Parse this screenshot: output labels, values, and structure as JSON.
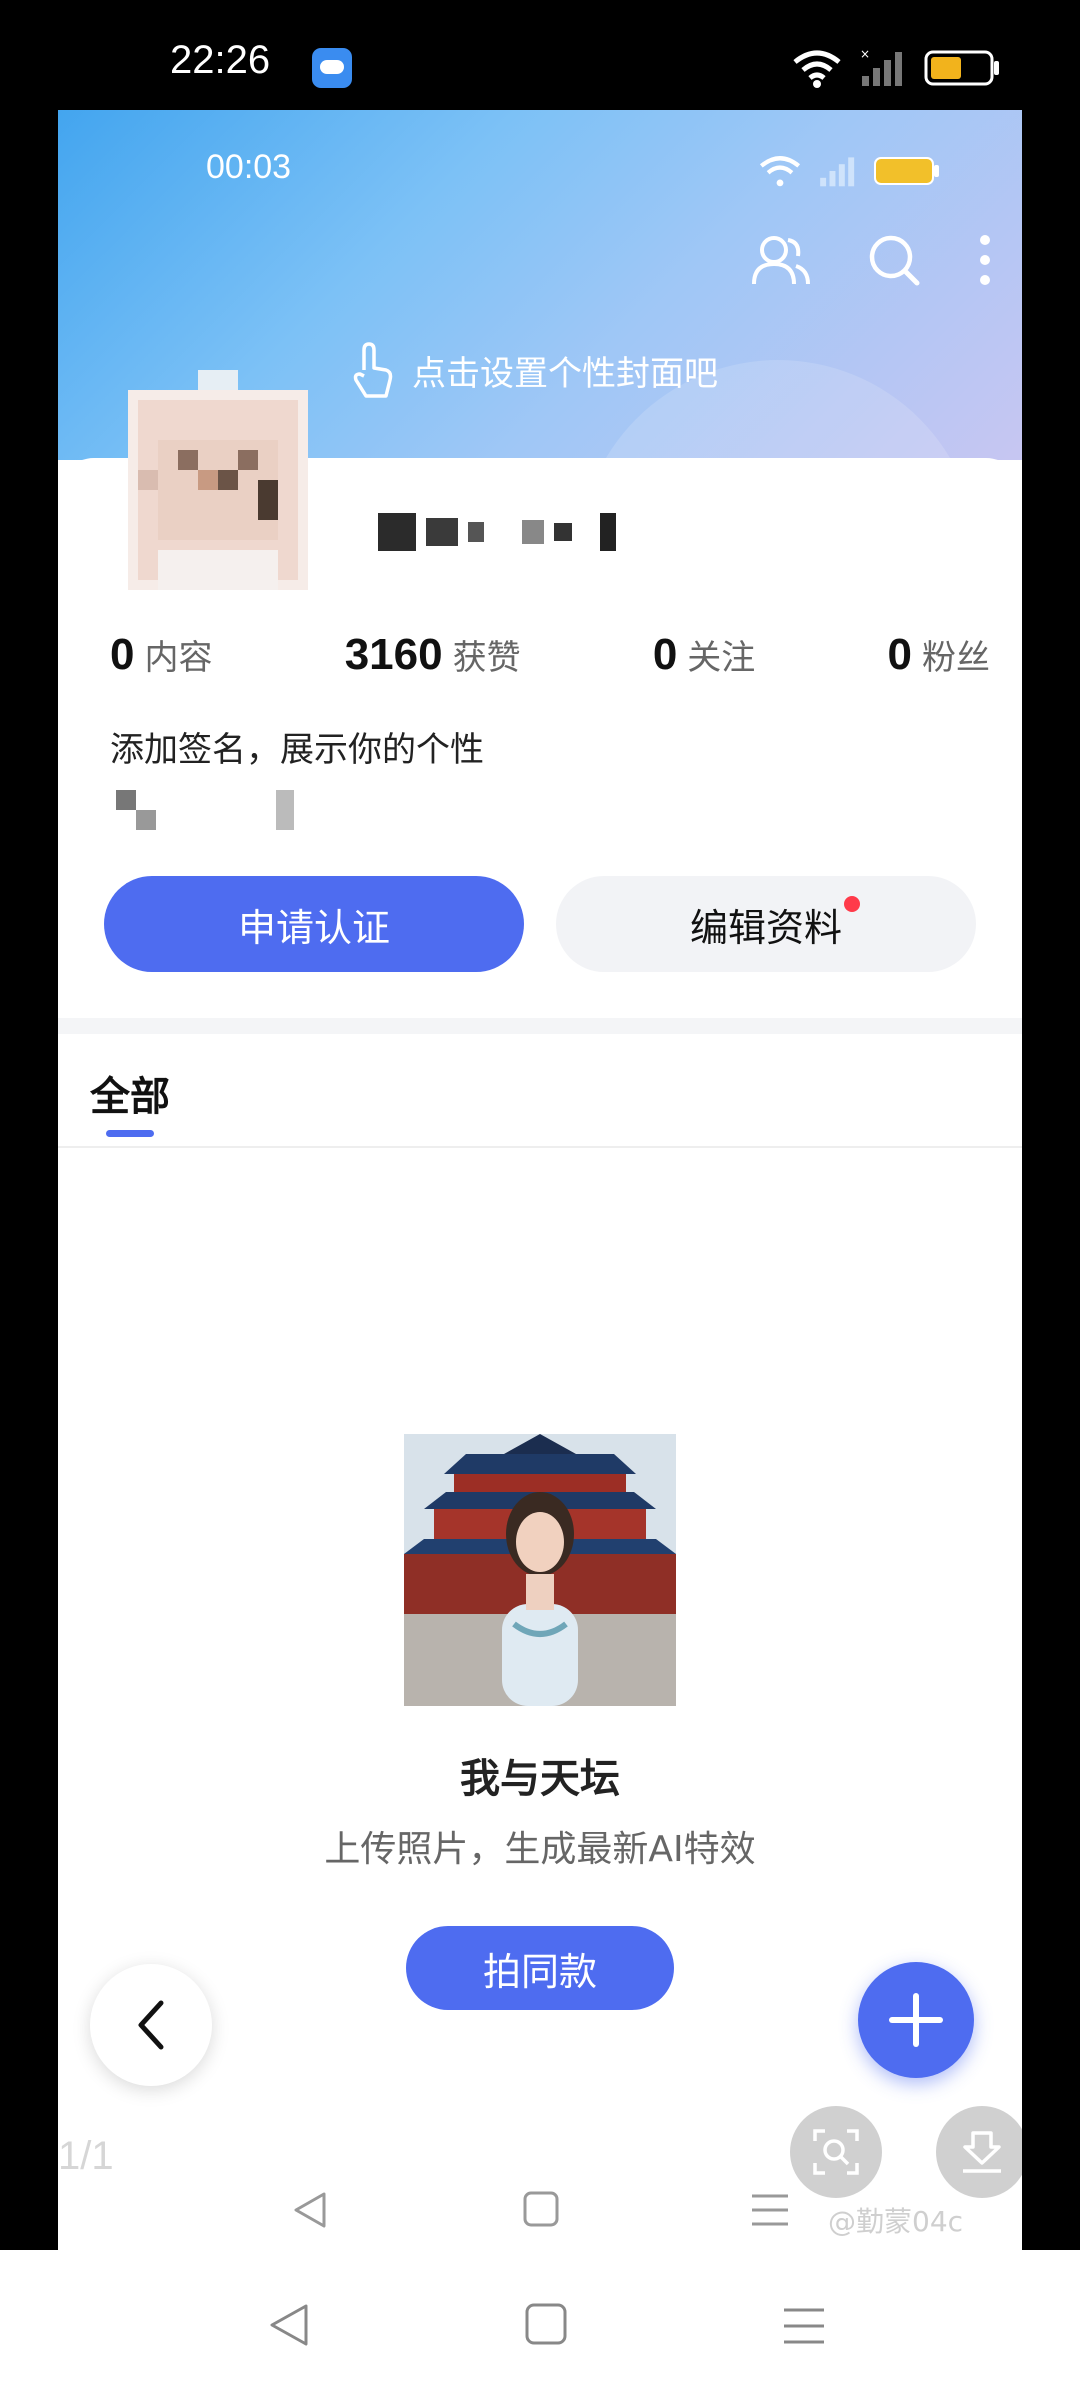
{
  "outer_status": {
    "time": "22:26"
  },
  "inner_status": {
    "time": "00:03"
  },
  "cover": {
    "hint": "点击设置个性封面吧"
  },
  "profile": {
    "stats": [
      {
        "value": "0",
        "label": "内容"
      },
      {
        "value": "3160",
        "label": "获赞"
      },
      {
        "value": "0",
        "label": "关注"
      },
      {
        "value": "0",
        "label": "粉丝"
      }
    ],
    "bio": "添加签名，展示你的个性",
    "verify_button": "申请认证",
    "edit_button": "编辑资料"
  },
  "tabs": {
    "all": "全部"
  },
  "promo": {
    "title": "我与天坛",
    "subtitle": "上传照片，生成最新AI特效",
    "button": "拍同款"
  },
  "viewer": {
    "page_counter": "1/1",
    "watermark": "@勤蒙04c"
  },
  "colors": {
    "accent": "#4e6cf0",
    "badge": "#ff3a4a"
  }
}
